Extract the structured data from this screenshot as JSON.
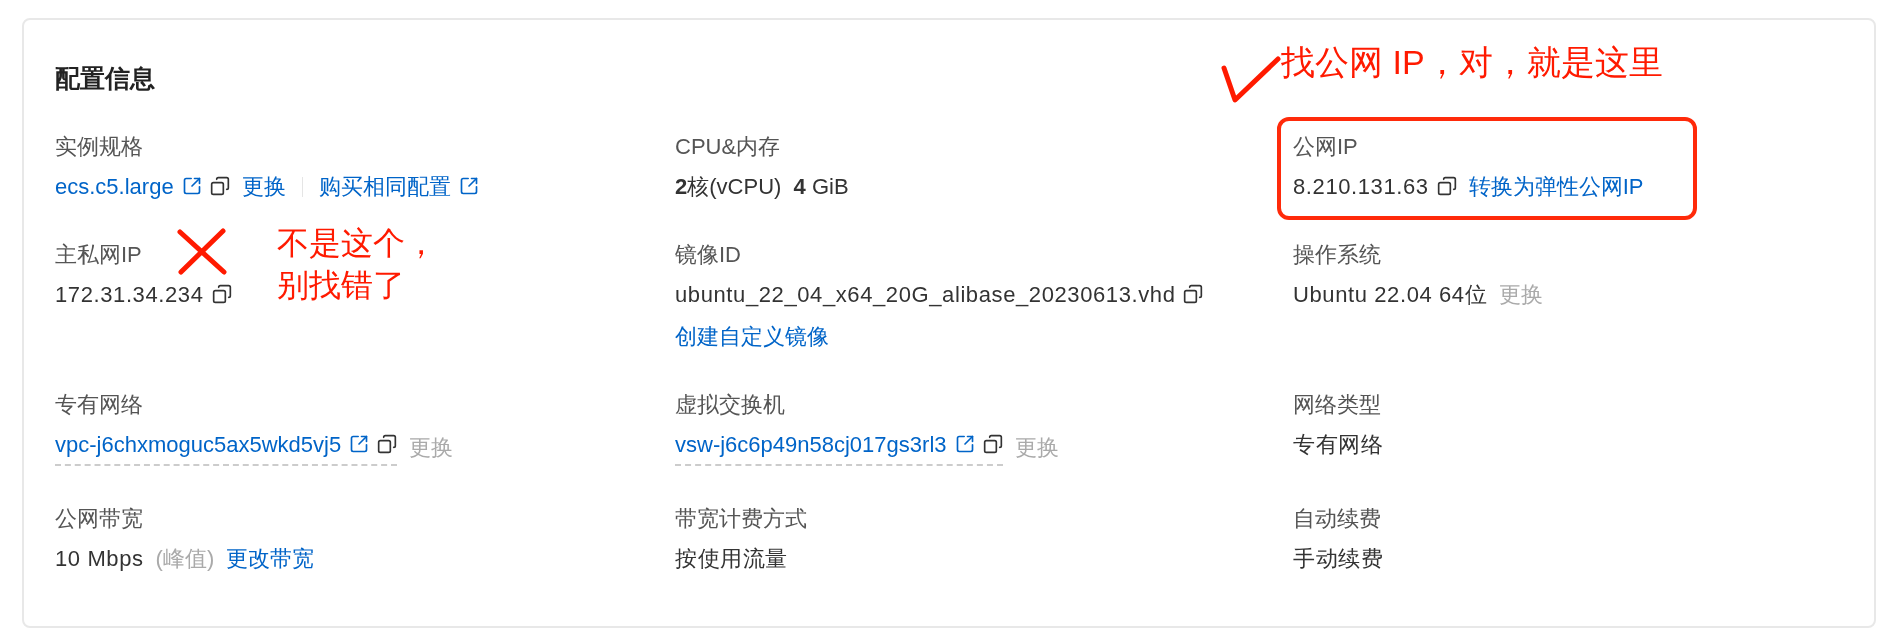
{
  "title": "配置信息",
  "items": [
    {
      "label": "实例规格",
      "parts": [
        {
          "kind": "link",
          "text": "ecs.c5.large",
          "external": true,
          "copy": true
        },
        {
          "kind": "link",
          "text": "更换"
        },
        {
          "kind": "separator"
        },
        {
          "kind": "link",
          "text": "购买相同配置",
          "external": true
        }
      ]
    },
    {
      "label": "CPU&内存",
      "parts": [
        {
          "kind": "rich",
          "text": "**2**核(vCPU)  **4** GiB"
        }
      ]
    },
    {
      "label": "公网IP",
      "annotation": {
        "kind": "check",
        "note": "找公网 IP，对，就是这里",
        "highlighted": true
      },
      "parts": [
        {
          "kind": "text",
          "text": "8.210.131.63",
          "copy": true
        },
        {
          "kind": "link",
          "text": "转换为弹性公网IP"
        }
      ]
    },
    {
      "label": "主私网IP",
      "annotation": {
        "kind": "cross",
        "note": "不是这个，别找错了"
      },
      "parts": [
        {
          "kind": "text",
          "text": "172.31.34.234",
          "copy": true
        }
      ]
    },
    {
      "label": "镜像ID",
      "parts": [
        {
          "kind": "text",
          "text": "ubuntu_22_04_x64_20G_alibase_20230613.vhd",
          "copy": true
        },
        {
          "kind": "link",
          "text": "创建自定义镜像"
        }
      ]
    },
    {
      "label": "操作系统",
      "parts": [
        {
          "kind": "text",
          "text": "Ubuntu 22.04 64位"
        },
        {
          "kind": "muted",
          "text": "更换"
        }
      ]
    },
    {
      "label": "专有网络",
      "parts": [
        {
          "kind": "link",
          "text": "vpc-j6chxmoguc5ax5wkd5vj5",
          "external": true,
          "copy": true,
          "underlined": true
        },
        {
          "kind": "muted",
          "text": "更换"
        }
      ]
    },
    {
      "label": "虚拟交换机",
      "parts": [
        {
          "kind": "link",
          "text": "vsw-j6c6p49n58cj017gs3rl3",
          "external": true,
          "copy": true,
          "underlined": true
        },
        {
          "kind": "muted",
          "text": "更换"
        }
      ]
    },
    {
      "label": "网络类型",
      "parts": [
        {
          "kind": "text",
          "text": "专有网络"
        }
      ]
    },
    {
      "label": "公网带宽",
      "parts": [
        {
          "kind": "text",
          "text": "10 Mbps"
        },
        {
          "kind": "muted",
          "text": "(峰值)"
        },
        {
          "kind": "link",
          "text": "更改带宽"
        }
      ]
    },
    {
      "label": "带宽计费方式",
      "parts": [
        {
          "kind": "text",
          "text": "按使用流量"
        }
      ]
    },
    {
      "label": "自动续费",
      "parts": [
        {
          "kind": "text",
          "text": "手动续费"
        }
      ]
    }
  ]
}
